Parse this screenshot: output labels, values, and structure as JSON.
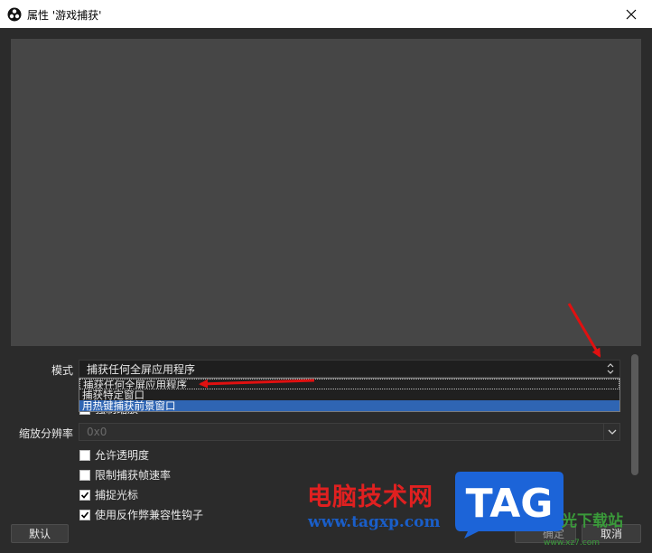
{
  "window": {
    "title": "属性 '游戏捕获'",
    "close_glyph": "✕"
  },
  "form": {
    "mode_label": "模式",
    "mode_value": "捕获任何全屏应用程序",
    "mode_options": [
      "捕获任何全屏应用程序",
      "捕获特定窗口",
      "用热键捕获前景窗口"
    ],
    "hidden_row_text": "强制缩放",
    "scale_label": "缩放分辨率",
    "scale_value": "0x0",
    "checkboxes": [
      {
        "label": "允许透明度",
        "checked": false
      },
      {
        "label": "限制捕获帧速率",
        "checked": false
      },
      {
        "label": "捕捉光标",
        "checked": true
      },
      {
        "label": "使用反作弊兼容性钩子",
        "checked": true
      }
    ]
  },
  "buttons": {
    "defaults": "默认",
    "ok_partial": "确定",
    "cancel": "取消"
  },
  "watermark": {
    "cn": "电脑技术网",
    "url": "www.tagxp.com",
    "tag": "TAG",
    "site": "光下载站",
    "site_url": "www.xz7.com"
  },
  "colors": {
    "accent_selected": "#2f65b3",
    "annotation_arrow": "#e01010"
  }
}
